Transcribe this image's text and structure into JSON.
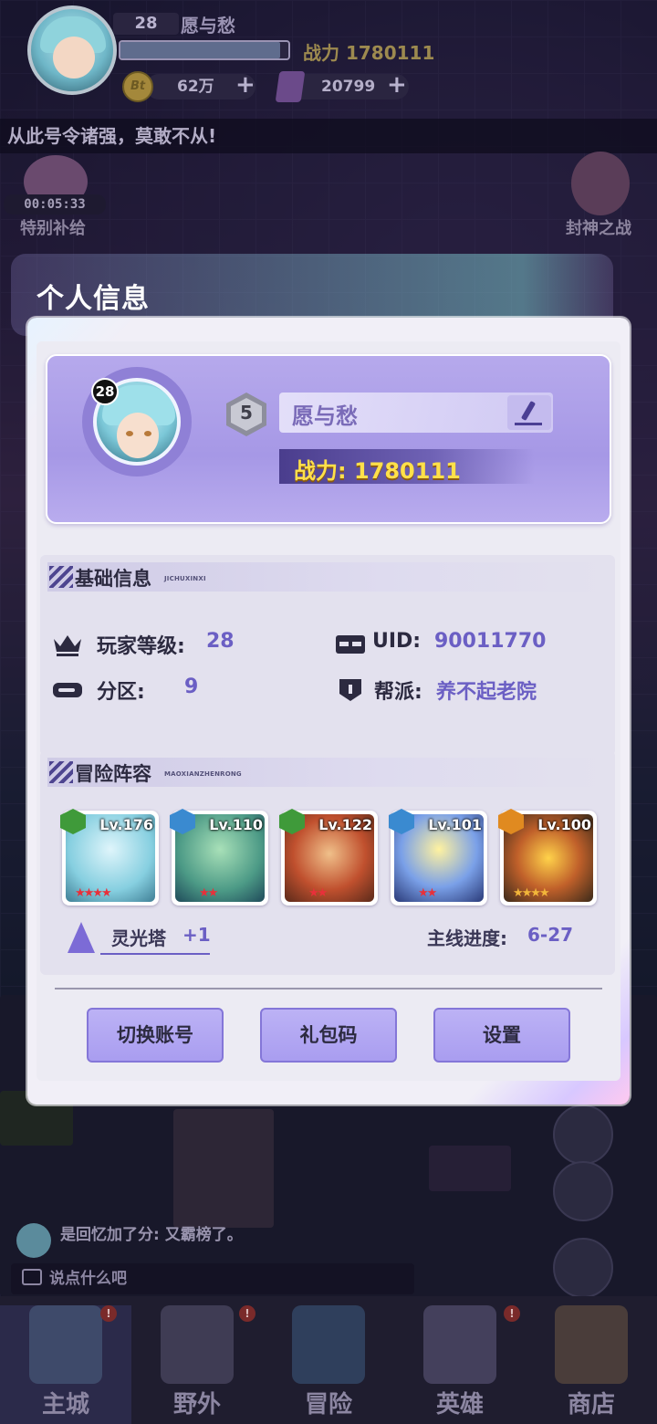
{
  "hud": {
    "level": "28",
    "name": "愿与愁",
    "power": "战力 1780111",
    "exp_fraction": 0.95,
    "coin_symbol": "Bt",
    "coins": "62万",
    "gems": "20799"
  },
  "marquee": "从此号令诸强，莫敢不从!",
  "side": {
    "timer": "00:05:33",
    "left_label": "特别补给",
    "right_label": "封神之战"
  },
  "modal": {
    "title": "个人信息",
    "profile": {
      "avatar_level": "28",
      "rank": "5",
      "name": "愿与愁",
      "power": "战力: 1780111"
    },
    "basic": {
      "title": "基础信息",
      "subtitle": "JICHUXINXI",
      "player_level_label": "玩家等级:",
      "player_level": "28",
      "uid_label": "UID:",
      "uid": "90011770",
      "zone_label": "分区:",
      "zone": "9",
      "guild_label": "帮派:",
      "guild": "养不起老院"
    },
    "lineup": {
      "title": "冒险阵容",
      "subtitle": "MAOXIANZHENRONG",
      "heroes": [
        {
          "level": "Lv.176",
          "stars": "★★★★",
          "element": "green"
        },
        {
          "level": "Lv.110",
          "stars": "★★",
          "element": "blue"
        },
        {
          "level": "Lv.122",
          "stars": "★★",
          "element": "green"
        },
        {
          "level": "Lv.101",
          "stars": "★★",
          "element": "blue"
        },
        {
          "level": "Lv.100",
          "stars": "★★★★",
          "element": "orange"
        }
      ],
      "tower_label": "灵光塔",
      "tower_value": "+1",
      "progress_label": "主线进度:",
      "progress_value": "6-27"
    },
    "buttons": {
      "switch_account": "切换账号",
      "gift_code": "礼包码",
      "settings": "设置"
    }
  },
  "chat": {
    "line": "是回忆加了分: 又霸榜了。",
    "placeholder": "说点什么吧"
  },
  "nav": {
    "items": [
      {
        "label": "主城"
      },
      {
        "label": "野外"
      },
      {
        "label": "冒险"
      },
      {
        "label": "英雄"
      },
      {
        "label": "商店"
      }
    ],
    "badge": "!"
  },
  "colors": {
    "accent": "#6b5fc4",
    "power_gold": "#ffe04a",
    "button": "#a99df0"
  }
}
